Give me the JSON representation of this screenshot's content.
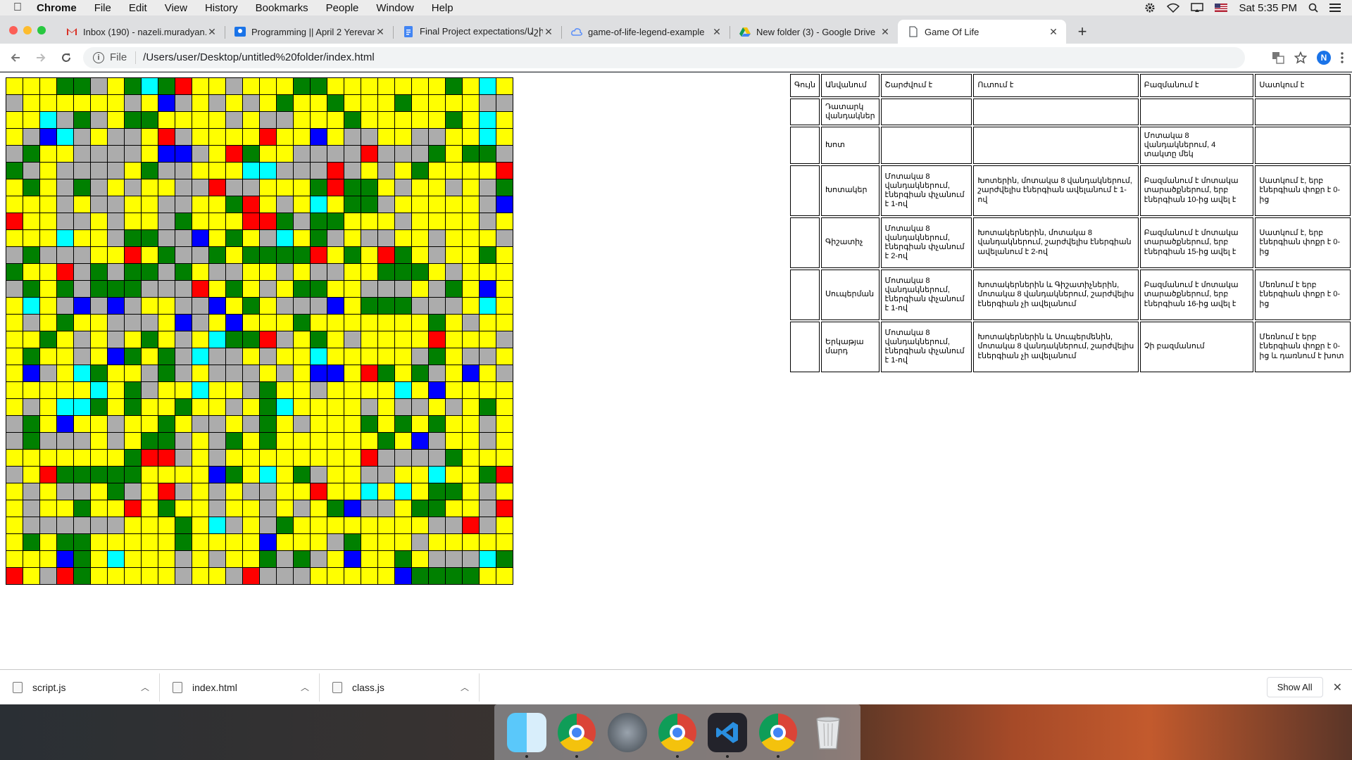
{
  "menubar": {
    "items": [
      "Chrome",
      "File",
      "Edit",
      "View",
      "History",
      "Bookmarks",
      "People",
      "Window",
      "Help"
    ],
    "clock": "Sat 5:35 PM",
    "icons": [
      "apple-icon",
      "gear-icon",
      "wifi-icon",
      "airplay-icon",
      "flag-icon",
      "search-icon",
      "menu-list-icon"
    ]
  },
  "tabs": [
    {
      "title": "Inbox (190) - nazeli.muradyan...",
      "icon": "gmail-icon",
      "color": "#d93025"
    },
    {
      "title": "Programming || April 2 Yerevan",
      "icon": "classroom-icon",
      "color": "#1a73e8"
    },
    {
      "title": "Final Project expectations/Աշխ",
      "icon": "docs-icon",
      "color": "#4285f4"
    },
    {
      "title": "game-of-life-legend-example",
      "icon": "cloud-icon",
      "color": "#5b8ff9"
    },
    {
      "title": "New folder (3) - Google Drive",
      "icon": "drive-icon",
      "color": "#0f9d58"
    },
    {
      "title": "Game Of Life",
      "icon": "page-icon",
      "color": "#5f6368",
      "active": true
    }
  ],
  "address": {
    "scheme": "File",
    "url": "/Users/user/Desktop/untitled%20folder/index.html"
  },
  "profile_initial": "N",
  "colors": {
    "0": "#acacac",
    "1": "#008000",
    "2": "#ffff00",
    "3": "#00ffff",
    "4": "#ff0000",
    "5": "#0000ff"
  },
  "grid": [
    "222110213142202221122222221232",
    "022222202502020212212221222200",
    "223010211222202002221222221232",
    "205302002402222422520022002232",
    "012200002550241220000400012110",
    "102000021002223300040202122224",
    "212010202200400222141120220201",
    "222020022002214202321102222205",
    "422002022012224410112220222202",
    "222322011005212032102002202220",
    "010002242100121111421241202212",
    "122401011012002202002211120222",
    "012101110004212021122000201252",
    "232050502200521200052111000232",
    "202122000250252221222222212022",
    "221202021202311402120222242220",
    "212202512103002022322222012002",
    "250231220102000202552412102520",
    "222223210223220122022223252222",
    "202331212212202132222020020212",
    "012522022120020120222121212202",
    "010002021102012122222212502202",
    "222222214402022222222400001222",
    "024111112222512321022002232214",
    "202002102402020022422323211202",
    "202212242122022020215002112204",
    "200000022212302012222222200402",
    "212112222212222522201222022222",
    "222512322202022101025221200031",
    "420412222202204000222225111122"
  ],
  "legend": {
    "headers": [
      "Գույն",
      "Անվանում",
      "Շարժվում է",
      "Ուտում է",
      "Բազմանում է",
      "Սատկում է"
    ],
    "rows": [
      {
        "color": "#808080",
        "name": "Դատարկ վանդակներ",
        "moves": "",
        "eats": "",
        "multiplies": "",
        "dies": ""
      },
      {
        "color": "#008000",
        "name": "Խոտ",
        "moves": "",
        "eats": "",
        "multiplies": "Մոտակա 8 վանդակներում, 4 տակտը մեկ",
        "dies": ""
      },
      {
        "color": "#ffff00",
        "name": "Խոտակեր",
        "moves": "Մոտակա 8 վանդակներում, էներգիան փչանում է 1-ով",
        "eats": "Խոտերին, մոտակա 8 վանդակներում, շարժվելիս էներգիան ավելանում է 1-ով",
        "multiplies": "Բազմանում է մոտակա տարածքներում, երբ էներգիան 10-ից ավել է",
        "dies": "Սատկում է, երբ էներգիան փոքր է 0-ից"
      },
      {
        "color": "#00ffff",
        "name": "Գիշատիչ",
        "moves": "Մոտակա 8 վանդակներում, էներգիան փչանում է 2-ով",
        "eats": "Խոտակերներին, մոտակա 8 վանդակներում, շարժվելիս էներգիան ավելանում է 2-ով",
        "multiplies": "Բազմանում է մոտակա տարածքներում, երբ էներգիան 15-ից ավել է",
        "dies": "Սատկում է, երբ էներգիան փոքր է 0-ից"
      },
      {
        "color": "#ff0000",
        "name": "Սուպերման",
        "moves": "Մոտակա 8 վանդակներում, էներգիան փչանում է 1-ով",
        "eats": "Խոտակերներին և Գիշատիչներին, մոտակա 8 վանդակներում, շարժվելիս էներգիան չի ավելանում",
        "multiplies": "Բազմանում է մոտակա տարածքներում, երբ էներգիան 16-ից ավել է",
        "dies": "Մեռնում է երբ էներգիան փոքր է 0-ից"
      },
      {
        "color": "#0000ff",
        "name": "Երկաթյա մարդ",
        "moves": "Մոտակա 8 վանդակներում, էներգիան փչանում է 1-ով",
        "eats": "Խոտակերներին և Սուպերմենին, մոտակա 8 վանդակներում, շարժվելիս էներգիան չի ավելանում",
        "multiplies": "Չի բազմանում",
        "dies": "Մեռնում է երբ էներգիան փոքր է 0-ից և դառնում է խոտ"
      }
    ]
  },
  "downloads": {
    "files": [
      "script.js",
      "index.html",
      "class.js"
    ],
    "show_all": "Show All"
  },
  "dock": [
    "finder-icon",
    "chrome-icon",
    "launchpad-icon",
    "chrome-icon",
    "vscode-icon",
    "chrome-icon",
    "trash-icon"
  ]
}
